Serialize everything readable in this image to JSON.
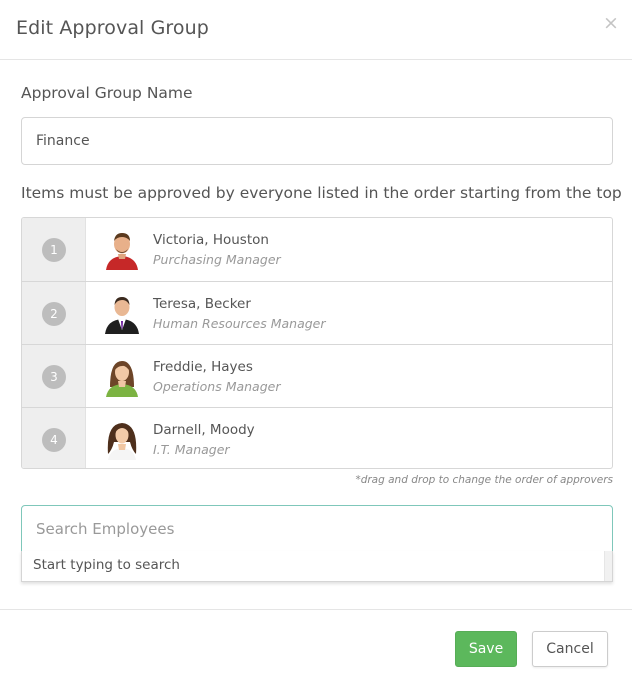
{
  "modal": {
    "title": "Edit Approval Group",
    "close_glyph": "×"
  },
  "form": {
    "name_label": "Approval Group Name",
    "name_value": "Finance",
    "instruction": "Items must be approved by everyone listed in the order starting from the top"
  },
  "approvers": [
    {
      "order": "1",
      "name": "Victoria, Houston",
      "role": "Purchasing Manager",
      "avatar_icon": "avatar-man-red-shirt"
    },
    {
      "order": "2",
      "name": "Teresa, Becker",
      "role": "Human Resources Manager",
      "avatar_icon": "avatar-man-suit"
    },
    {
      "order": "3",
      "name": "Freddie, Hayes",
      "role": "Operations Manager",
      "avatar_icon": "avatar-woman-green-top"
    },
    {
      "order": "4",
      "name": "Darnell, Moody",
      "role": "I.T. Manager",
      "avatar_icon": "avatar-woman-curly-hair"
    }
  ],
  "drag_hint": "*drag and drop to change the order of approvers",
  "search": {
    "placeholder": "Search Employees",
    "hint": "Start typing to search"
  },
  "footer": {
    "save_label": "Save",
    "cancel_label": "Cancel"
  },
  "colors": {
    "save_green": "#5cb85c",
    "search_focus": "#7fc7ba",
    "badge_gray": "#bdbdbd"
  }
}
